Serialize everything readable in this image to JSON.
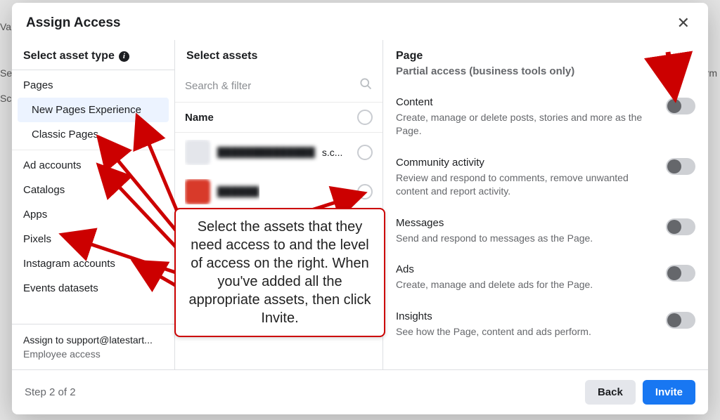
{
  "modal": {
    "title": "Assign Access",
    "step_label": "Step 2 of 2",
    "back_label": "Back",
    "invite_label": "Invite"
  },
  "asset_types": {
    "header": "Select asset type",
    "items": [
      {
        "label": "Pages"
      },
      {
        "label": "New Pages Experience",
        "sub": true,
        "selected": true
      },
      {
        "label": "Classic Pages",
        "sub": true
      },
      {
        "label": "Ad accounts"
      },
      {
        "label": "Catalogs"
      },
      {
        "label": "Apps"
      },
      {
        "label": "Pixels"
      },
      {
        "label": "Instagram accounts"
      },
      {
        "label": "Events datasets"
      }
    ],
    "assign_to_label": "Assign to support@latestart...",
    "assign_role": "Employee access"
  },
  "assets": {
    "header": "Select assets",
    "search_placeholder": "Search & filter",
    "name_header": "Name",
    "rows": [
      {
        "thumb": "grey",
        "name_blurred": "██████████████",
        "suffix": "s.c..."
      },
      {
        "thumb": "red",
        "name_blurred": "██████",
        "suffix": ""
      }
    ]
  },
  "permissions": {
    "title": "Page",
    "subtitle": "Partial access (business tools only)",
    "items": [
      {
        "name": "Content",
        "desc": "Create, manage or delete posts, stories and more as the Page.",
        "on": false
      },
      {
        "name": "Community activity",
        "desc": "Review and respond to comments, remove unwanted content and report activity.",
        "on": false
      },
      {
        "name": "Messages",
        "desc": "Send and respond to messages as the Page.",
        "on": false
      },
      {
        "name": "Ads",
        "desc": "Create, manage and delete ads for the Page.",
        "on": false
      },
      {
        "name": "Insights",
        "desc": "See how the Page, content and ads perform.",
        "on": false
      }
    ]
  },
  "annotation": {
    "text": "Select the assets that they need access to and the level of access on the right. When you've added all the appropriate assets, then click Invite."
  },
  "colors": {
    "primary": "#1877f2",
    "annotation": "#c00"
  }
}
